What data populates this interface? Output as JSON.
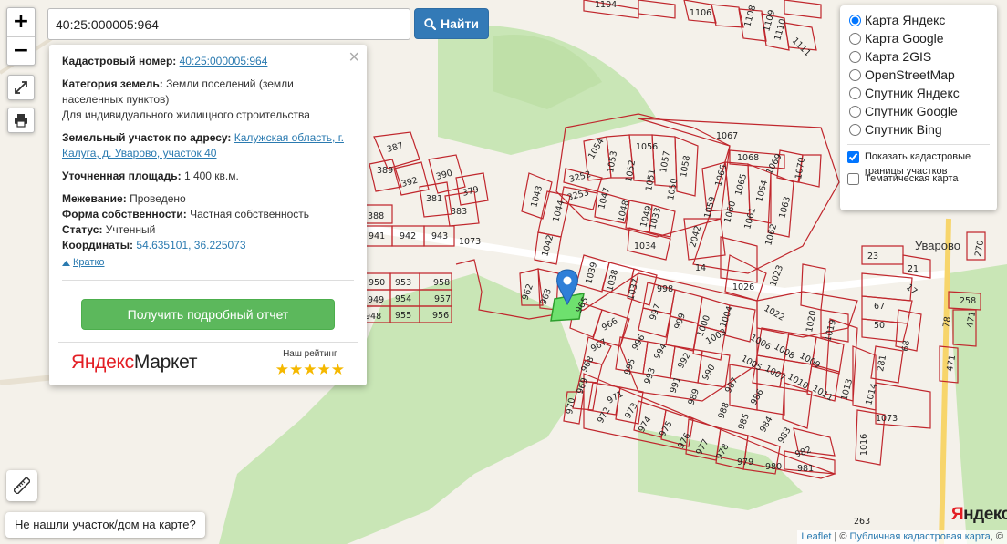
{
  "search": {
    "value": "40:25:000005:964",
    "button_label": "Найти"
  },
  "zoom": {
    "in_label": "+",
    "out_label": "−"
  },
  "popup": {
    "close_label": "×",
    "cadastral_label": "Кадастровый номер:",
    "cadastral_value": "40:25:000005:964",
    "category_label": "Категория земель:",
    "category_value": "Земли поселений (земли населенных пунктов)",
    "usage_value": "Для индивидуального жилищного строительства",
    "address_label": "Земельный участок по адресу:",
    "address_value": "Калужская область, г. Калуга, д. Уварово, участок 40",
    "area_label": "Уточненная площадь:",
    "area_value": "1 400 кв.м.",
    "survey_label": "Межевание:",
    "survey_value": "Проведено",
    "ownership_label": "Форма собственности:",
    "ownership_value": "Частная собственность",
    "status_label": "Статус:",
    "status_value": "Учтенный",
    "coords_label": "Координаты:",
    "coords_value": "54.635101, 36.225073",
    "short_link": "Кратко",
    "report_button": "Получить подробный отчет",
    "ad_brand_ya": "Яндекс",
    "ad_brand_market": "Маркет",
    "ad_rating_label": "Наш рейтинг",
    "ad_stars": "★★★★★"
  },
  "layers": {
    "options": [
      "Карта Яндекс",
      "Карта Google",
      "Карта 2GIS",
      "OpenStreetMap",
      "Спутник Яндекс",
      "Спутник Google",
      "Спутник Bing"
    ],
    "selected": "Карта Яндекс",
    "show_borders_label": "Показать кадастровые границы участков",
    "show_borders_checked": true,
    "thematic_label": "Тематическая карта",
    "thematic_checked": false
  },
  "map": {
    "village_label": "Уварово",
    "yandex_logo_ya": "Я",
    "yandex_logo_rest": "ндекс",
    "parcels": [
      "387",
      "389",
      "392",
      "390",
      "379",
      "381",
      "383",
      "388",
      "941",
      "942",
      "943",
      "1073",
      "950",
      "953",
      "958",
      "949",
      "954",
      "957",
      "948",
      "955",
      "956",
      "962",
      "963",
      "964",
      "965",
      "966",
      "967",
      "968",
      "969",
      "970",
      "971",
      "972",
      "973",
      "974",
      "975",
      "976",
      "977",
      "978",
      "979",
      "980",
      "981",
      "982",
      "983",
      "984",
      "985",
      "986",
      "987",
      "988",
      "989",
      "990",
      "991",
      "992",
      "993",
      "994",
      "995",
      "996",
      "997",
      "998",
      "999",
      "1000",
      "1003",
      "1004",
      "1005",
      "1006",
      "1007",
      "1008",
      "1009",
      "1010",
      "1011",
      "1013",
      "1014",
      "1016",
      "1019",
      "1020",
      "1022",
      "1023",
      "1026",
      "1033",
      "1034",
      "1037",
      "1038",
      "1039",
      "1042",
      "1043",
      "1044",
      "1047",
      "1048",
      "1049",
      "1050",
      "1051",
      "1052",
      "1053",
      "1054",
      "1056",
      "1057",
      "1058",
      "1059",
      "1060",
      "1061",
      "1062",
      "1063",
      "1064",
      "1065",
      "1066",
      "1067",
      "1068",
      "1069",
      "1070",
      "1104",
      "1106",
      "1108",
      "1109",
      "1110",
      "1111",
      "3252",
      "3253",
      "14",
      "23",
      "21",
      "17",
      "67",
      "50",
      "68",
      "281",
      "258",
      "78",
      "471",
      "263",
      "270"
    ]
  },
  "bottom": {
    "not_found_label": "Не нашли участок/дом на карте?"
  },
  "attribution": {
    "leaflet": "Leaflet",
    "separator": " | © ",
    "pkk": "Публичная кадастровая карта",
    "tail": ", ©"
  },
  "colors": {
    "parcel_border": "#c0272d",
    "selected_parcel": "#6ee06e",
    "marker": "#2f7fd8",
    "green_area": "#c9e6b6",
    "search_button": "#337ab7",
    "report_button": "#5cb85c"
  }
}
